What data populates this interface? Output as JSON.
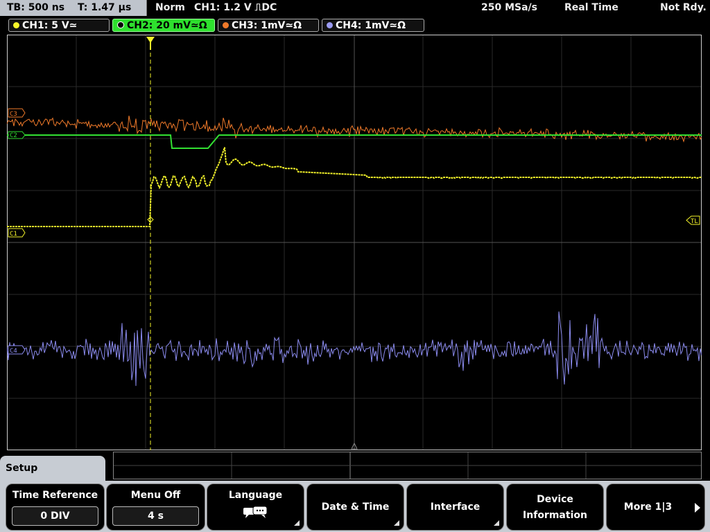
{
  "topbar": {
    "timebase": "TB: 500 ns",
    "trigger_pos": "T: 1.47 µs",
    "mode": "Norm",
    "trigger": "CH1: 1.2 V ⎍DC",
    "sample_rate": "250 MSa/s",
    "acq_mode": "Real Time",
    "state": "Not Rdy."
  },
  "channels": [
    {
      "label": "CH1: 5 V≃",
      "color": "#f5f52a",
      "active": false
    },
    {
      "label": "CH2: 20 mV≃Ω",
      "color": "#3ce63c",
      "active": true
    },
    {
      "label": "CH3: 1mV≃Ω",
      "color": "#f07a2a",
      "active": false
    },
    {
      "label": "CH4: 1mV≃Ω",
      "color": "#9a9af0",
      "active": false
    }
  ],
  "markers": {
    "c1": "C1",
    "c2": "C2",
    "c3": "C3",
    "c4": "C4",
    "tl": "TL"
  },
  "menu": {
    "title": "Setup",
    "softkeys": [
      {
        "label": "Time Reference",
        "value": "0 DIV"
      },
      {
        "label": "Menu Off",
        "value": "4 s"
      },
      {
        "label": "Language",
        "icon": "speech-bubbles-icon"
      },
      {
        "label": "Date & Time"
      },
      {
        "label": "Interface"
      },
      {
        "label_line1": "Device",
        "label_line2": "Information"
      },
      {
        "label": "More 1|3"
      }
    ]
  }
}
